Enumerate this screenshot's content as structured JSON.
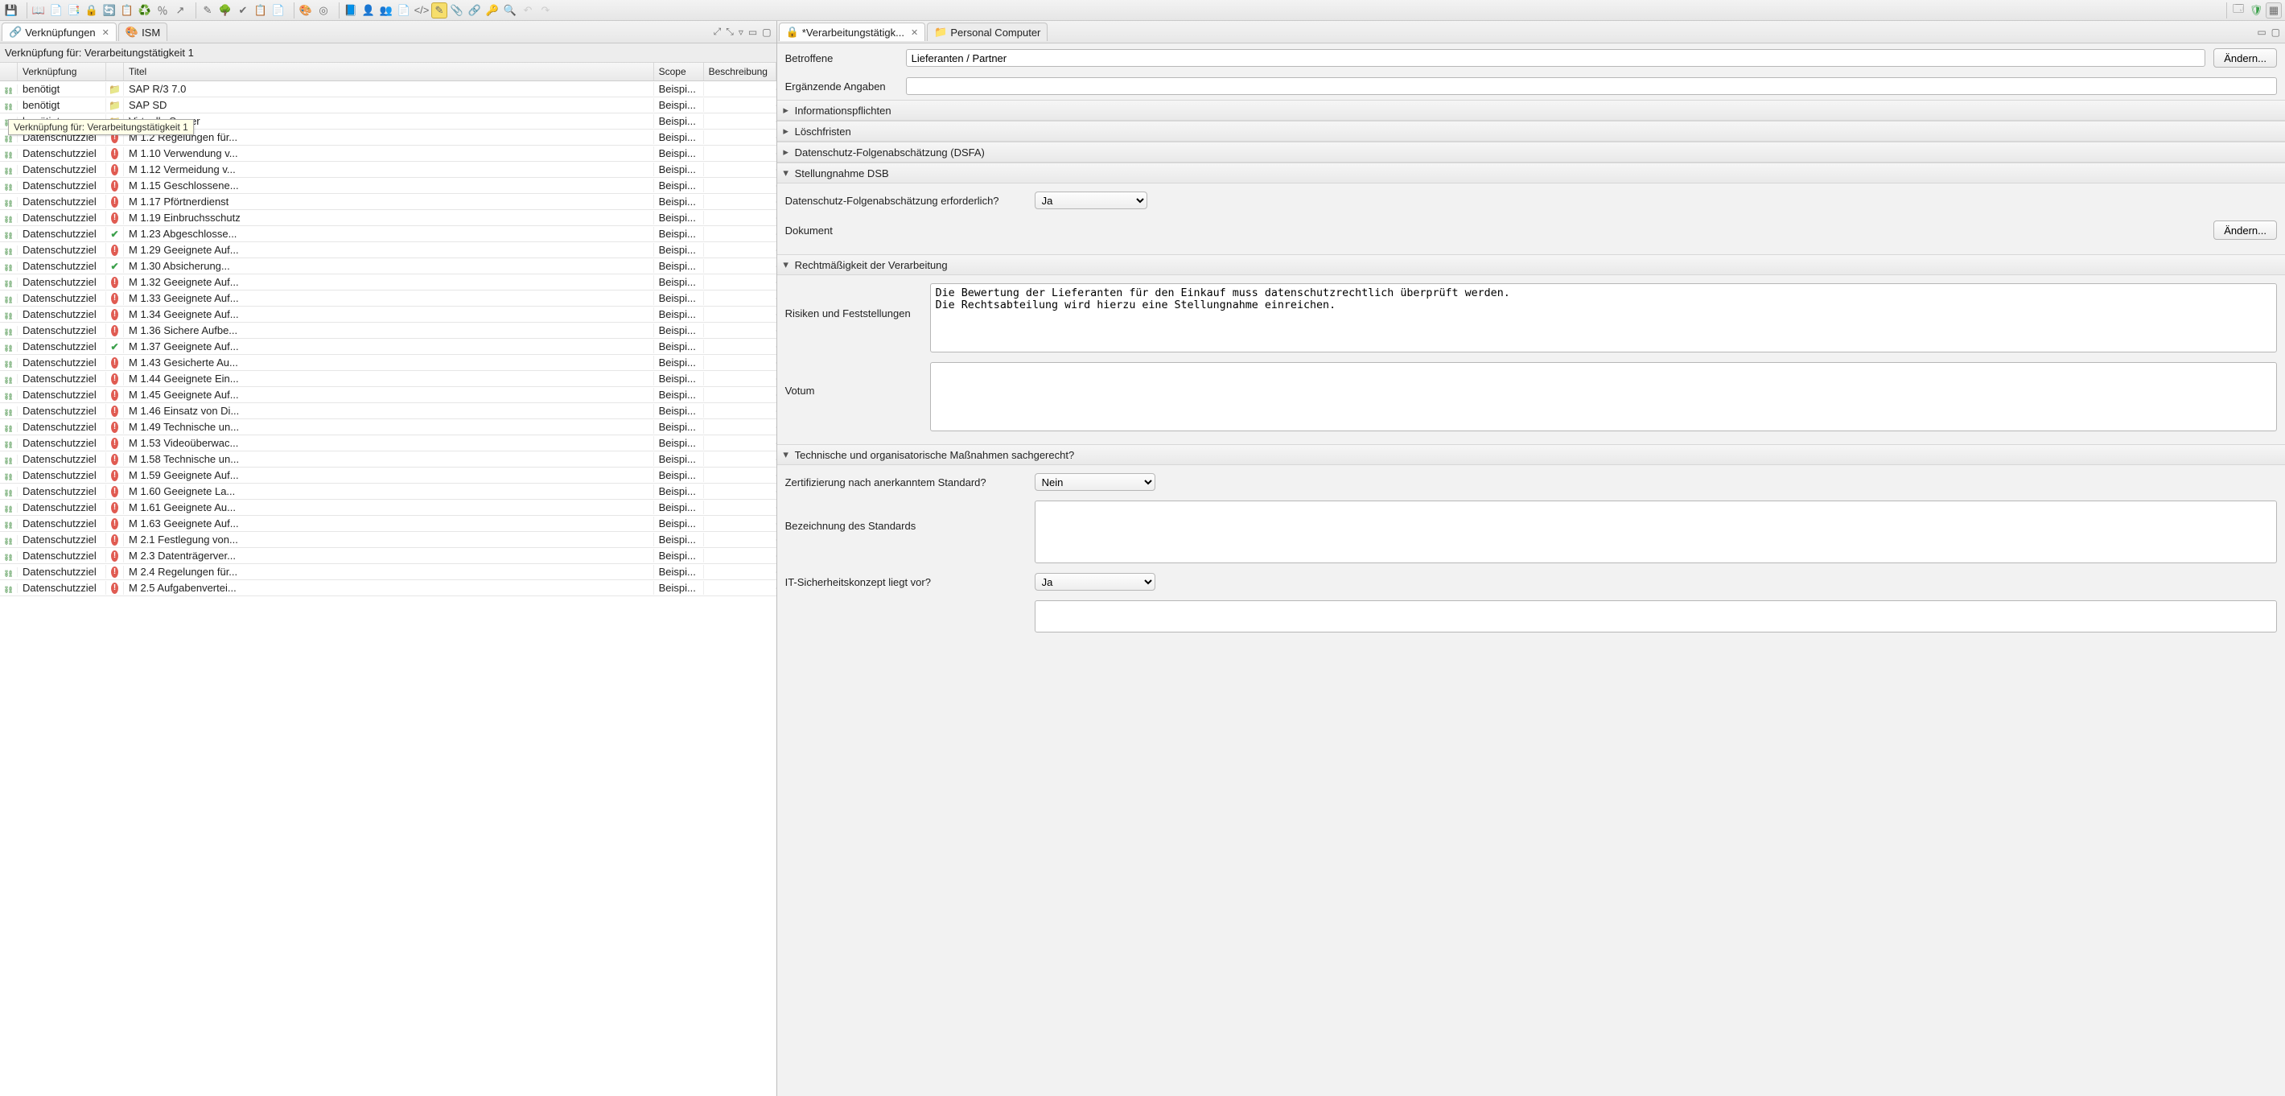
{
  "toolbar": {
    "icons": [
      "save-icon",
      "sep",
      "book-icon",
      "copy-icon",
      "paste-icon",
      "lock-icon",
      "refresh-icon",
      "list-icon",
      "cycle-icon",
      "percent-icon",
      "export-icon",
      "sep",
      "pen-icon",
      "tree-icon",
      "check-icon",
      "clipboard-icon",
      "page-icon",
      "sep",
      "palette-icon",
      "target-icon",
      "sep",
      "book2-icon",
      "user-icon",
      "users-icon",
      "doc-icon",
      "code-icon",
      "note-icon",
      "attach-icon",
      "link-icon",
      "key-icon",
      "search-icon",
      "undo-icon",
      "redo-icon"
    ],
    "right_icons": [
      "perspective-icon",
      "shield-ok-icon",
      "grid-icon"
    ]
  },
  "left": {
    "tabs": [
      {
        "icon": "link-icon",
        "label": "Verknüpfungen",
        "active": true,
        "closable": true
      },
      {
        "icon": "palette-icon",
        "label": "ISM",
        "active": false,
        "closable": false
      }
    ],
    "table_title": "Verknüpfung für: Verarbeitungstätigkeit 1",
    "tooltip": "Verknüpfung für: Verarbeitungstätigkeit 1",
    "columns": {
      "link": "Verknüpfung",
      "title": "Titel",
      "scope": "Scope",
      "desc": "Beschreibung"
    },
    "rows": [
      {
        "link": "benötigt",
        "ticon": "folder",
        "title": "SAP R/3 7.0",
        "scope": "Beispi..."
      },
      {
        "link": "benötigt",
        "ticon": "folder",
        "title": "SAP SD",
        "scope": "Beispi..."
      },
      {
        "link": "benötigt",
        "ticon": "folder",
        "title": "Virtuelle Server",
        "scope": "Beispi..."
      },
      {
        "link": "Datenschutzziel",
        "ticon": "alert",
        "title": "M 1.2 Regelungen für...",
        "scope": "Beispi..."
      },
      {
        "link": "Datenschutzziel",
        "ticon": "alert",
        "title": "M 1.10 Verwendung v...",
        "scope": "Beispi..."
      },
      {
        "link": "Datenschutzziel",
        "ticon": "alert",
        "title": "M 1.12 Vermeidung v...",
        "scope": "Beispi..."
      },
      {
        "link": "Datenschutzziel",
        "ticon": "alert",
        "title": "M 1.15 Geschlossene...",
        "scope": "Beispi..."
      },
      {
        "link": "Datenschutzziel",
        "ticon": "alert",
        "title": "M 1.17 Pförtnerdienst",
        "scope": "Beispi..."
      },
      {
        "link": "Datenschutzziel",
        "ticon": "alert",
        "title": "M 1.19 Einbruchsschutz",
        "scope": "Beispi..."
      },
      {
        "link": "Datenschutzziel",
        "ticon": "check",
        "title": "M 1.23 Abgeschlosse...",
        "scope": "Beispi..."
      },
      {
        "link": "Datenschutzziel",
        "ticon": "alert",
        "title": "M 1.29 Geeignete Auf...",
        "scope": "Beispi..."
      },
      {
        "link": "Datenschutzziel",
        "ticon": "check",
        "title": "M 1.30 Absicherung...",
        "scope": "Beispi..."
      },
      {
        "link": "Datenschutzziel",
        "ticon": "alert",
        "title": "M 1.32 Geeignete Auf...",
        "scope": "Beispi..."
      },
      {
        "link": "Datenschutzziel",
        "ticon": "alert",
        "title": "M 1.33 Geeignete Auf...",
        "scope": "Beispi..."
      },
      {
        "link": "Datenschutzziel",
        "ticon": "alert",
        "title": "M 1.34 Geeignete Auf...",
        "scope": "Beispi..."
      },
      {
        "link": "Datenschutzziel",
        "ticon": "alert",
        "title": "M 1.36 Sichere Aufbe...",
        "scope": "Beispi..."
      },
      {
        "link": "Datenschutzziel",
        "ticon": "check",
        "title": "M 1.37 Geeignete Auf...",
        "scope": "Beispi..."
      },
      {
        "link": "Datenschutzziel",
        "ticon": "alert",
        "title": "M 1.43 Gesicherte Au...",
        "scope": "Beispi..."
      },
      {
        "link": "Datenschutzziel",
        "ticon": "alert",
        "title": "M 1.44 Geeignete Ein...",
        "scope": "Beispi..."
      },
      {
        "link": "Datenschutzziel",
        "ticon": "alert",
        "title": "M 1.45 Geeignete Auf...",
        "scope": "Beispi..."
      },
      {
        "link": "Datenschutzziel",
        "ticon": "alert",
        "title": "M 1.46 Einsatz von Di...",
        "scope": "Beispi..."
      },
      {
        "link": "Datenschutzziel",
        "ticon": "alert",
        "title": "M 1.49 Technische un...",
        "scope": "Beispi..."
      },
      {
        "link": "Datenschutzziel",
        "ticon": "alert",
        "title": "M 1.53 Videoüberwac...",
        "scope": "Beispi..."
      },
      {
        "link": "Datenschutzziel",
        "ticon": "alert",
        "title": "M 1.58 Technische un...",
        "scope": "Beispi..."
      },
      {
        "link": "Datenschutzziel",
        "ticon": "alert",
        "title": "M 1.59 Geeignete Auf...",
        "scope": "Beispi..."
      },
      {
        "link": "Datenschutzziel",
        "ticon": "alert",
        "title": "M 1.60 Geeignete La...",
        "scope": "Beispi..."
      },
      {
        "link": "Datenschutzziel",
        "ticon": "alert",
        "title": "M 1.61 Geeignete Au...",
        "scope": "Beispi..."
      },
      {
        "link": "Datenschutzziel",
        "ticon": "alert",
        "title": "M 1.63 Geeignete Auf...",
        "scope": "Beispi..."
      },
      {
        "link": "Datenschutzziel",
        "ticon": "alert",
        "title": "M 2.1 Festlegung von...",
        "scope": "Beispi..."
      },
      {
        "link": "Datenschutzziel",
        "ticon": "alert",
        "title": "M 2.3 Datenträgerver...",
        "scope": "Beispi..."
      },
      {
        "link": "Datenschutzziel",
        "ticon": "alert",
        "title": "M 2.4 Regelungen für...",
        "scope": "Beispi..."
      },
      {
        "link": "Datenschutzziel",
        "ticon": "alert",
        "title": "M 2.5 Aufgabenvertei...",
        "scope": "Beispi..."
      }
    ]
  },
  "right": {
    "tabs": [
      {
        "icon": "lock-icon",
        "label": "*Verarbeitungstätigk...",
        "active": true,
        "closable": true
      },
      {
        "icon": "folder-icon",
        "label": "Personal Computer",
        "active": false,
        "closable": false
      }
    ],
    "betroffene_label": "Betroffene",
    "betroffene_value": "Lieferanten / Partner",
    "btn_aendern": "Ändern...",
    "erg_label": "Ergänzende Angaben",
    "erg_value": "",
    "sections": {
      "info": "Informationspflichten",
      "loesch": "Löschfristen",
      "dsfa": "Datenschutz-Folgenabschätzung (DSFA)",
      "stellungnahme": "Stellungnahme DSB",
      "recht": "Rechtmäßigkeit der Verarbeitung",
      "tom": "Technische und organisatorische Maßnahmen sachgerecht?"
    },
    "dsfa_req_label": "Datenschutz-Folgenabschätzung erforderlich?",
    "dsfa_req_value": "Ja",
    "dokument_label": "Dokument",
    "btn_aendern2": "Ändern...",
    "risiken_label": "Risiken und Feststellungen",
    "risiken_value": "Die Bewertung der Lieferanten für den Einkauf muss datenschutzrechtlich überprüft werden.\nDie Rechtsabteilung wird hierzu eine Stellungnahme einreichen.",
    "votum_label": "Votum",
    "votum_value": "",
    "zert_label": "Zertifizierung nach anerkanntem Standard?",
    "zert_value": "Nein",
    "bez_label": "Bezeichnung des Standards",
    "bez_value": "",
    "itsec_label": "IT-Sicherheitskonzept liegt vor?",
    "itsec_value": "Ja"
  }
}
